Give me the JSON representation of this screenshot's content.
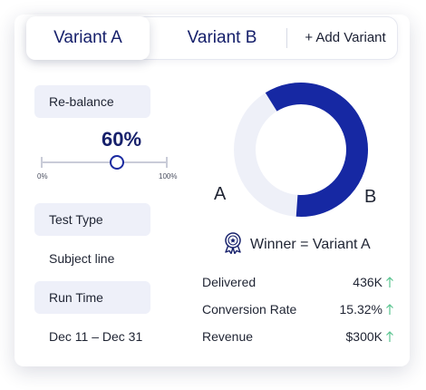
{
  "tabs": [
    {
      "label": "Variant A",
      "active": true
    },
    {
      "label": "Variant B",
      "active": false
    }
  ],
  "add_variant_label": "+ Add Variant",
  "rebalance": {
    "label": "Re-balance",
    "percent_label": "60%",
    "value_percent": 60,
    "min_label": "0%",
    "max_label": "100%"
  },
  "test_type": {
    "label": "Test Type",
    "value": "Subject line"
  },
  "run_time": {
    "label": "Run Time",
    "value": "Dec 11 – Dec 31"
  },
  "split": {
    "left_label": "A",
    "right_label": "B",
    "variant_a_share": 0.6,
    "colors": {
      "a": "#1628a3",
      "b": "#eef0f8"
    }
  },
  "winner": {
    "text": "Winner = Variant A",
    "icon": "award-badge-icon"
  },
  "stats": [
    {
      "label": "Delivered",
      "value": "436K",
      "trend": "up"
    },
    {
      "label": "Conversion Rate",
      "value": "15.32%",
      "trend": "up"
    },
    {
      "label": "Revenue",
      "value": "$300K",
      "trend": "up"
    }
  ],
  "colors": {
    "accent": "#16206b",
    "trend_up": "#59c48f"
  }
}
